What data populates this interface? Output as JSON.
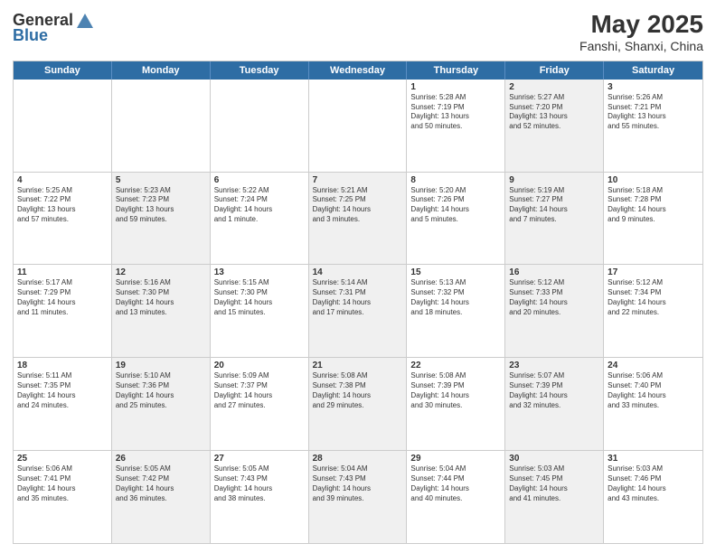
{
  "header": {
    "logo_general": "General",
    "logo_blue": "Blue",
    "month_year": "May 2025",
    "location": "Fanshi, Shanxi, China"
  },
  "day_headers": [
    "Sunday",
    "Monday",
    "Tuesday",
    "Wednesday",
    "Thursday",
    "Friday",
    "Saturday"
  ],
  "weeks": [
    [
      {
        "day": "",
        "info": "",
        "shaded": false
      },
      {
        "day": "",
        "info": "",
        "shaded": false
      },
      {
        "day": "",
        "info": "",
        "shaded": false
      },
      {
        "day": "",
        "info": "",
        "shaded": false
      },
      {
        "day": "1",
        "info": "Sunrise: 5:28 AM\nSunset: 7:19 PM\nDaylight: 13 hours\nand 50 minutes.",
        "shaded": false
      },
      {
        "day": "2",
        "info": "Sunrise: 5:27 AM\nSunset: 7:20 PM\nDaylight: 13 hours\nand 52 minutes.",
        "shaded": true
      },
      {
        "day": "3",
        "info": "Sunrise: 5:26 AM\nSunset: 7:21 PM\nDaylight: 13 hours\nand 55 minutes.",
        "shaded": false
      }
    ],
    [
      {
        "day": "4",
        "info": "Sunrise: 5:25 AM\nSunset: 7:22 PM\nDaylight: 13 hours\nand 57 minutes.",
        "shaded": false
      },
      {
        "day": "5",
        "info": "Sunrise: 5:23 AM\nSunset: 7:23 PM\nDaylight: 13 hours\nand 59 minutes.",
        "shaded": true
      },
      {
        "day": "6",
        "info": "Sunrise: 5:22 AM\nSunset: 7:24 PM\nDaylight: 14 hours\nand 1 minute.",
        "shaded": false
      },
      {
        "day": "7",
        "info": "Sunrise: 5:21 AM\nSunset: 7:25 PM\nDaylight: 14 hours\nand 3 minutes.",
        "shaded": true
      },
      {
        "day": "8",
        "info": "Sunrise: 5:20 AM\nSunset: 7:26 PM\nDaylight: 14 hours\nand 5 minutes.",
        "shaded": false
      },
      {
        "day": "9",
        "info": "Sunrise: 5:19 AM\nSunset: 7:27 PM\nDaylight: 14 hours\nand 7 minutes.",
        "shaded": true
      },
      {
        "day": "10",
        "info": "Sunrise: 5:18 AM\nSunset: 7:28 PM\nDaylight: 14 hours\nand 9 minutes.",
        "shaded": false
      }
    ],
    [
      {
        "day": "11",
        "info": "Sunrise: 5:17 AM\nSunset: 7:29 PM\nDaylight: 14 hours\nand 11 minutes.",
        "shaded": false
      },
      {
        "day": "12",
        "info": "Sunrise: 5:16 AM\nSunset: 7:30 PM\nDaylight: 14 hours\nand 13 minutes.",
        "shaded": true
      },
      {
        "day": "13",
        "info": "Sunrise: 5:15 AM\nSunset: 7:30 PM\nDaylight: 14 hours\nand 15 minutes.",
        "shaded": false
      },
      {
        "day": "14",
        "info": "Sunrise: 5:14 AM\nSunset: 7:31 PM\nDaylight: 14 hours\nand 17 minutes.",
        "shaded": true
      },
      {
        "day": "15",
        "info": "Sunrise: 5:13 AM\nSunset: 7:32 PM\nDaylight: 14 hours\nand 18 minutes.",
        "shaded": false
      },
      {
        "day": "16",
        "info": "Sunrise: 5:12 AM\nSunset: 7:33 PM\nDaylight: 14 hours\nand 20 minutes.",
        "shaded": true
      },
      {
        "day": "17",
        "info": "Sunrise: 5:12 AM\nSunset: 7:34 PM\nDaylight: 14 hours\nand 22 minutes.",
        "shaded": false
      }
    ],
    [
      {
        "day": "18",
        "info": "Sunrise: 5:11 AM\nSunset: 7:35 PM\nDaylight: 14 hours\nand 24 minutes.",
        "shaded": false
      },
      {
        "day": "19",
        "info": "Sunrise: 5:10 AM\nSunset: 7:36 PM\nDaylight: 14 hours\nand 25 minutes.",
        "shaded": true
      },
      {
        "day": "20",
        "info": "Sunrise: 5:09 AM\nSunset: 7:37 PM\nDaylight: 14 hours\nand 27 minutes.",
        "shaded": false
      },
      {
        "day": "21",
        "info": "Sunrise: 5:08 AM\nSunset: 7:38 PM\nDaylight: 14 hours\nand 29 minutes.",
        "shaded": true
      },
      {
        "day": "22",
        "info": "Sunrise: 5:08 AM\nSunset: 7:39 PM\nDaylight: 14 hours\nand 30 minutes.",
        "shaded": false
      },
      {
        "day": "23",
        "info": "Sunrise: 5:07 AM\nSunset: 7:39 PM\nDaylight: 14 hours\nand 32 minutes.",
        "shaded": true
      },
      {
        "day": "24",
        "info": "Sunrise: 5:06 AM\nSunset: 7:40 PM\nDaylight: 14 hours\nand 33 minutes.",
        "shaded": false
      }
    ],
    [
      {
        "day": "25",
        "info": "Sunrise: 5:06 AM\nSunset: 7:41 PM\nDaylight: 14 hours\nand 35 minutes.",
        "shaded": false
      },
      {
        "day": "26",
        "info": "Sunrise: 5:05 AM\nSunset: 7:42 PM\nDaylight: 14 hours\nand 36 minutes.",
        "shaded": true
      },
      {
        "day": "27",
        "info": "Sunrise: 5:05 AM\nSunset: 7:43 PM\nDaylight: 14 hours\nand 38 minutes.",
        "shaded": false
      },
      {
        "day": "28",
        "info": "Sunrise: 5:04 AM\nSunset: 7:43 PM\nDaylight: 14 hours\nand 39 minutes.",
        "shaded": true
      },
      {
        "day": "29",
        "info": "Sunrise: 5:04 AM\nSunset: 7:44 PM\nDaylight: 14 hours\nand 40 minutes.",
        "shaded": false
      },
      {
        "day": "30",
        "info": "Sunrise: 5:03 AM\nSunset: 7:45 PM\nDaylight: 14 hours\nand 41 minutes.",
        "shaded": true
      },
      {
        "day": "31",
        "info": "Sunrise: 5:03 AM\nSunset: 7:46 PM\nDaylight: 14 hours\nand 43 minutes.",
        "shaded": false
      }
    ]
  ]
}
